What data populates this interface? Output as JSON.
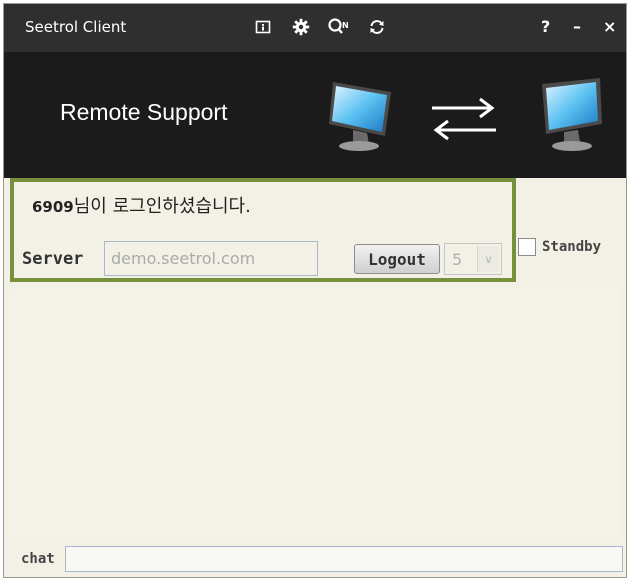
{
  "window": {
    "title": "Seetrol Client",
    "toolbar_icons": [
      "info-icon",
      "gear-icon",
      "search-connect-icon",
      "refresh-icon"
    ],
    "help_label": "?",
    "minimize_label": "–",
    "close_label": "×"
  },
  "banner": {
    "title": "Remote Support",
    "icons": [
      "monitor-icon",
      "swap-arrows-icon",
      "monitor-icon"
    ]
  },
  "login": {
    "user_id": "6909",
    "status_message": "님이 로그인하셨습니다.",
    "server_label": "Server",
    "server_value": "demo.seetrol.com",
    "logout_label": "Logout",
    "channel_value": "5"
  },
  "standby": {
    "label": "Standby",
    "checked": false
  },
  "chat": {
    "label": "chat",
    "value": ""
  },
  "colors": {
    "titlebar_bg": "#2f2f2f",
    "banner_bg": "#1b1b1b",
    "panel_bg": "#f3f1e6",
    "highlight_border": "#76903f"
  }
}
